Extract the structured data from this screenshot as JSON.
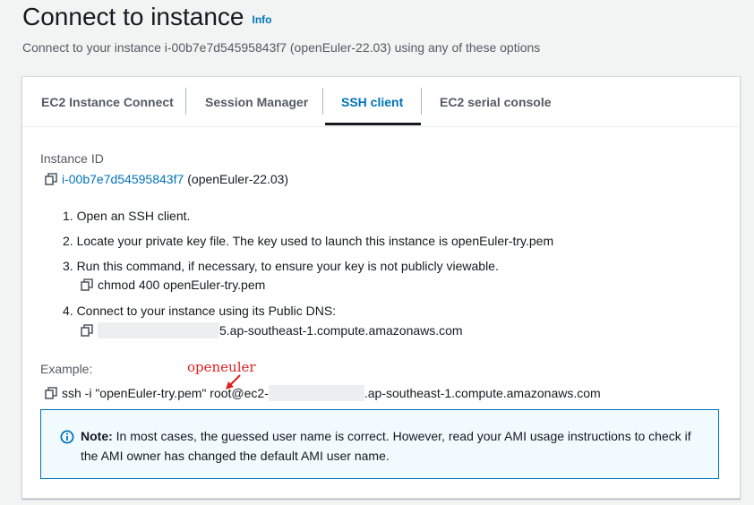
{
  "header": {
    "title": "Connect to instance",
    "info_link": "Info",
    "subtitle": "Connect to your instance i-00b7e7d54595843f7 (openEuler-22.03) using any of these options"
  },
  "tabs": [
    {
      "label": "EC2 Instance Connect",
      "active": false
    },
    {
      "label": "Session Manager",
      "active": false
    },
    {
      "label": "SSH client",
      "active": true
    },
    {
      "label": "EC2 serial console",
      "active": false
    }
  ],
  "instance": {
    "label": "Instance ID",
    "id": "i-00b7e7d54595843f7",
    "name": "(openEuler-22.03)"
  },
  "steps": {
    "s1": "1. Open an SSH client.",
    "s2": "2. Locate your private key file. The key used to launch this instance is openEuler-try.pem",
    "s3": "3. Run this command, if necessary, to ensure your key is not publicly viewable.",
    "s3_command": "chmod 400 openEuler-try.pem",
    "s4": "4. Connect to your instance using its Public DNS:",
    "s4_dns_suffix": "5.ap-southeast-1.compute.amazonaws.com"
  },
  "example": {
    "label": "Example:",
    "command_prefix": "ssh -i \"openEuler-try.pem\" root@ec2-",
    "command_suffix": ".ap-southeast-1.compute.amazonaws.com",
    "annotation": "openeuler"
  },
  "note": {
    "title": "Note:",
    "text": " In most cases, the guessed user name is correct. However, read your AMI usage instructions to check if the AMI owner has changed the default AMI user name."
  },
  "colors": {
    "accent": "#0073bb",
    "annotation": "#e02020",
    "note_bg": "#f1faff"
  },
  "icons": {
    "copy": "copy-icon",
    "info": "info-circle-icon",
    "arrow": "red-arrow-icon"
  }
}
